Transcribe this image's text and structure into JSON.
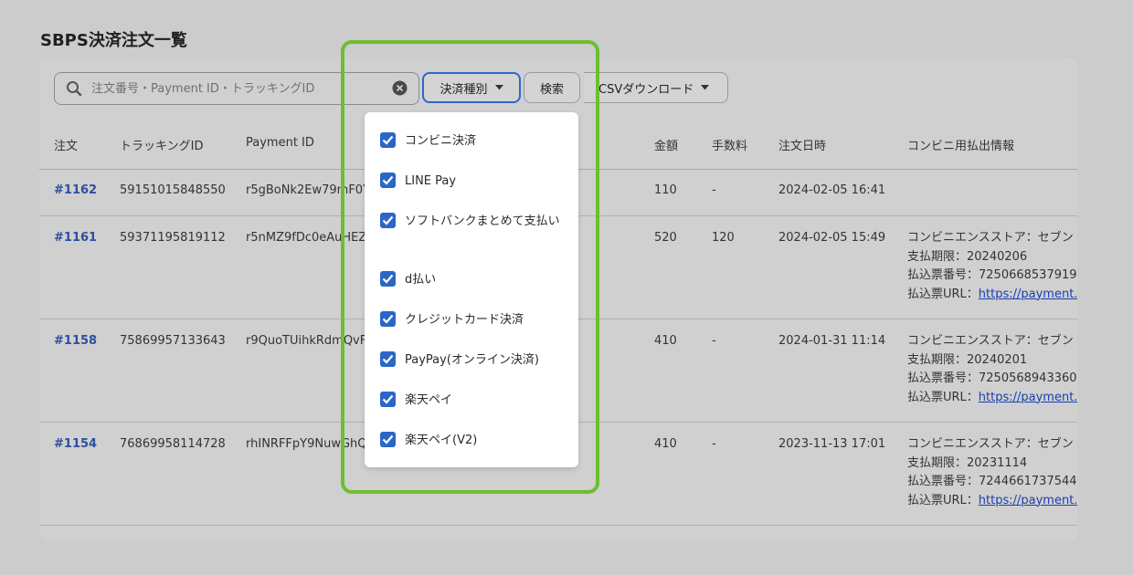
{
  "page": {
    "title": "SBPS決済注文一覧"
  },
  "toolbar": {
    "search_placeholder": "注文番号・Payment ID・トラッキングID",
    "payment_type_label": "決済種別",
    "search_label": "検索",
    "csv_label": "CSVダウンロード"
  },
  "table": {
    "headers": {
      "order": "注文",
      "tracking": "トラッキングID",
      "payment_id": "Payment ID",
      "amount": "金額",
      "fee": "手数料",
      "date": "注文日時",
      "konbini": "コンビニ用払出情報"
    },
    "rows": [
      {
        "order": "#1162",
        "tracking": "59151015848550",
        "payment_id": "r5gBoNk2Ew79mF0Y",
        "amount": "110",
        "fee": "-",
        "date": "2024-02-05 16:41",
        "info": []
      },
      {
        "order": "#1161",
        "tracking": "59371195819112",
        "payment_id": "r5nMZ9fDc0eAuHEZT",
        "amount": "520",
        "fee": "120",
        "date": "2024-02-05 15:49",
        "info": [
          "コンビニエンスストア：セブン",
          "支払期限：20240206",
          "払込票番号：7250668537919",
          "払込票URL：",
          "https://payment.s"
        ]
      },
      {
        "order": "#1158",
        "tracking": "75869957133643",
        "payment_id": "r9QuoTUihkRdmQvF",
        "amount": "410",
        "fee": "-",
        "date": "2024-01-31 11:14",
        "info": [
          "コンビニエンスストア：セブン",
          "支払期限：20240201",
          "払込票番号：7250568943360",
          "払込票URL：",
          "https://payment.s"
        ]
      },
      {
        "order": "#1154",
        "tracking": "76869958114728",
        "payment_id": "rhINRFFpY9NuwGhQs",
        "amount": "410",
        "fee": "-",
        "date": "2023-11-13 17:01",
        "info": [
          "コンビニエンスストア：セブン",
          "支払期限：20231114",
          "払込票番号：7244661737544",
          "払込票URL：",
          "https://payment.s"
        ]
      }
    ]
  },
  "dropdown": {
    "items": [
      {
        "label": "コンビニ決済",
        "checked": true
      },
      {
        "label": "LINE Pay",
        "checked": true
      },
      {
        "label": "ソフトバンクまとめて支払い",
        "checked": true
      },
      {
        "label": "d払い",
        "checked": true
      },
      {
        "label": "クレジットカード決済",
        "checked": true
      },
      {
        "label": "PayPay(オンライン決済)",
        "checked": true
      },
      {
        "label": "楽天ペイ",
        "checked": true
      },
      {
        "label": "楽天ペイ(V2)",
        "checked": true
      }
    ]
  },
  "colors": {
    "accent": "#2b66c7",
    "highlight": "#6dbf2e",
    "link": "#2b4fa0"
  }
}
